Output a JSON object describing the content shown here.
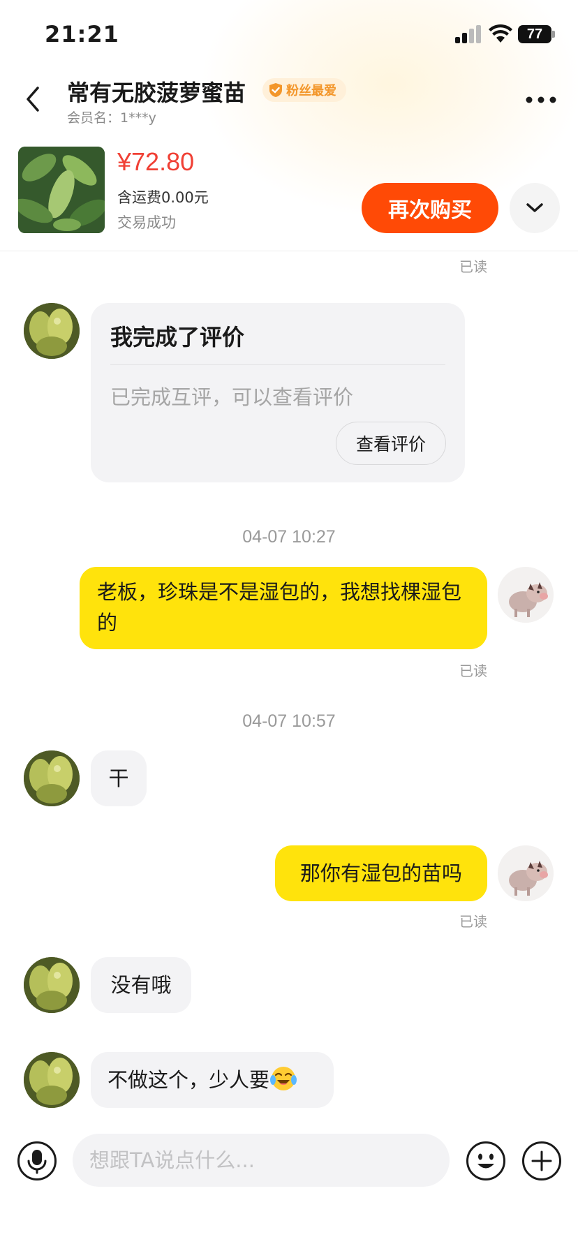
{
  "status_bar": {
    "time": "21:21",
    "battery": "77"
  },
  "header": {
    "shop_name": "常有无胶菠萝蜜苗",
    "badge": "粉丝最爱",
    "member_label": "会员名：1***y"
  },
  "product": {
    "price": "¥72.80",
    "shipping": "含运费0.00元",
    "status": "交易成功",
    "buy_again": "再次购买"
  },
  "review_card": {
    "title": "我完成了评价",
    "description": "已完成互评，可以查看评价",
    "button": "查看评价"
  },
  "messages": {
    "read_label": "已读",
    "timestamp_1": "04-07 10:27",
    "out_1": "老板，珍珠是不是湿包的，我想找棵湿包的",
    "timestamp_2": "04-07 10:57",
    "in_1": "干",
    "out_2": "那你有湿包的苗吗",
    "in_2": "没有哦",
    "in_3": "不做这个，少人要",
    "in_3_emoji": "crying-laughing-emoji"
  },
  "composer": {
    "placeholder": "想跟TA说点什么..."
  },
  "colors": {
    "accent_orange": "#ff4a06",
    "price_red": "#f04035",
    "bubble_yellow": "#ffe30c",
    "bubble_gray": "#f3f3f5",
    "badge_orange": "#f3962a"
  },
  "icons": [
    "back-icon",
    "more-icon",
    "chevron-down-icon",
    "mic-icon",
    "emoji-icon",
    "plus-icon",
    "signal-icon",
    "wifi-icon",
    "badge-shield-icon"
  ]
}
